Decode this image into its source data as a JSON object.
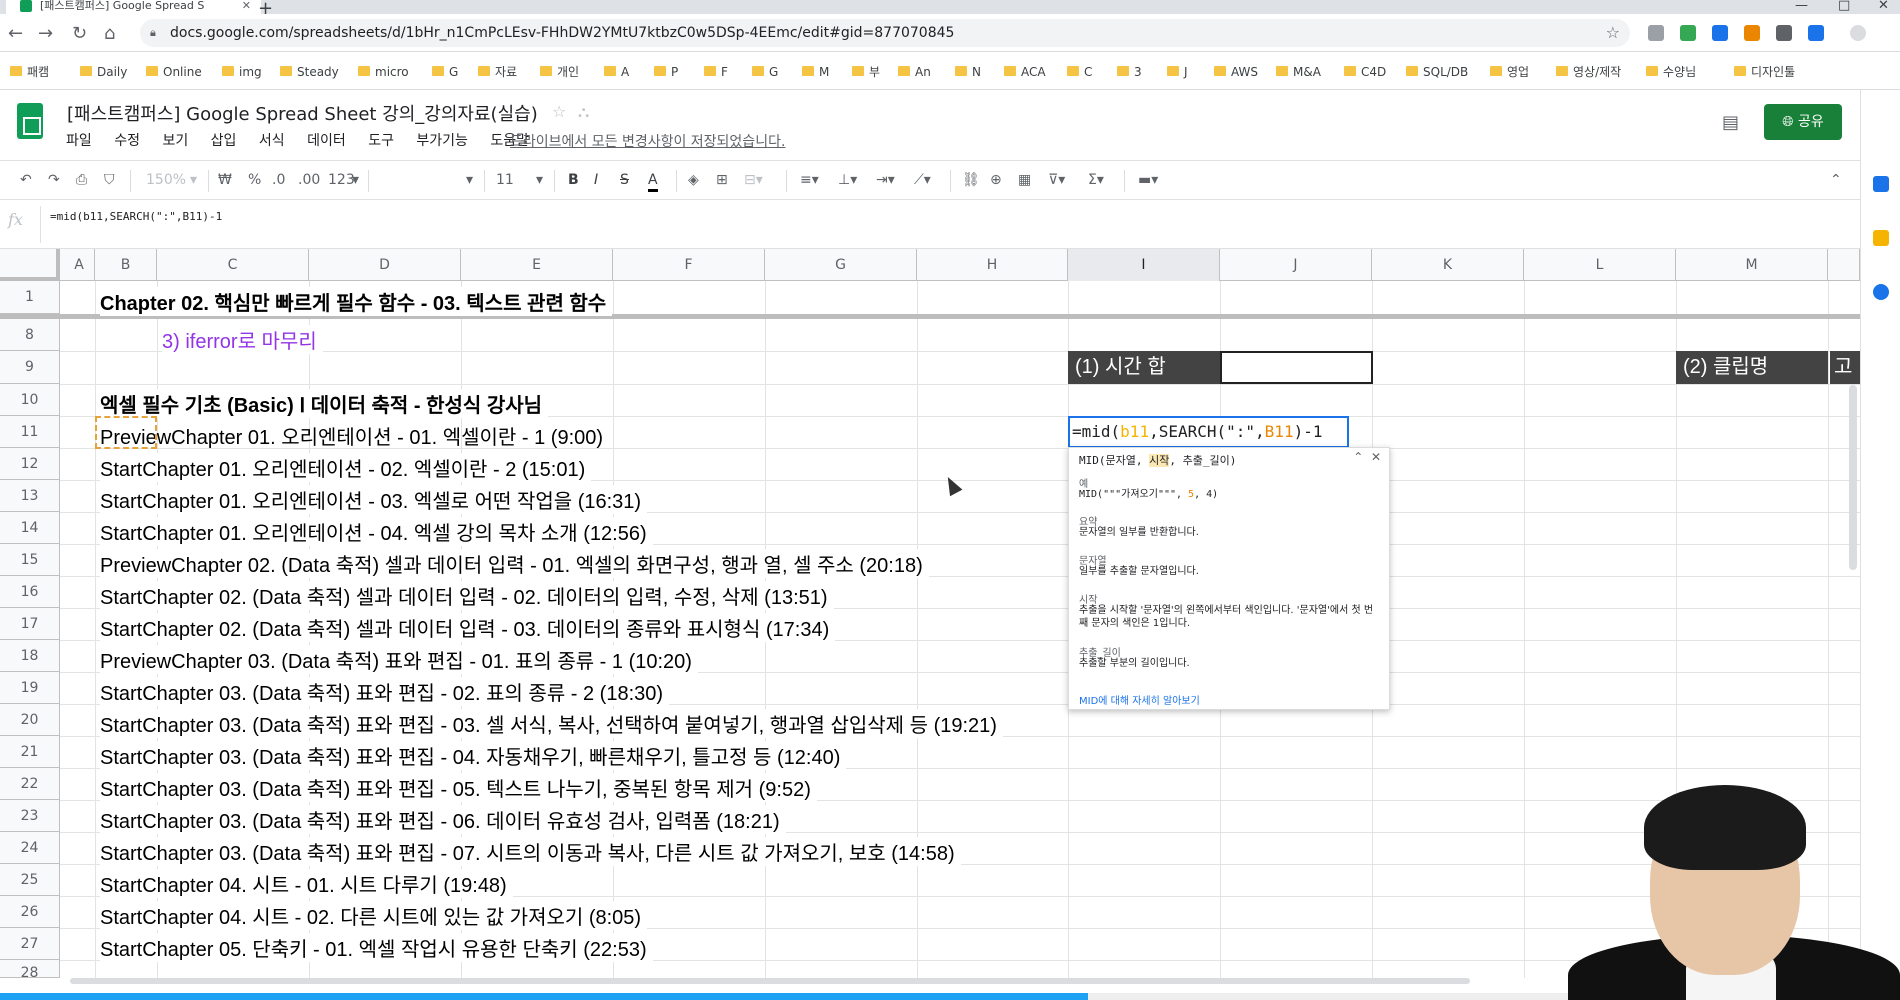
{
  "browser": {
    "tab_title": "[패스트캠퍼스] Google Spread S",
    "url": "docs.google.com/spreadsheets/d/1bHr_n1CmPcLEsv-FHhDW2YMtU7ktbzC0w5DSp-4EEmc/edit#gid=877070845",
    "bookmarks": [
      "패캠",
      "Daily",
      "Online",
      "img",
      "Steady",
      "micro",
      "G",
      "자료",
      "개인",
      "A",
      "P",
      "F",
      "G",
      "M",
      "부",
      "An",
      "N",
      "ACA",
      "C",
      "3",
      "J",
      "AWS",
      "M&A",
      "C4D",
      "SQL/DB",
      "영업",
      "영상/제작",
      "수양님",
      "디자인툴"
    ]
  },
  "doc": {
    "title": "[패스트캠퍼스] Google Spread Sheet 강의_강의자료(실습)",
    "menus": [
      "파일",
      "수정",
      "보기",
      "삽입",
      "서식",
      "데이터",
      "도구",
      "부가기능",
      "도움말"
    ],
    "save_status": "드라이브에서 모든 변경사항이 저장되었습니다.",
    "share_label": "공유"
  },
  "toolbar": {
    "zoom": "150%",
    "currency": "₩",
    "percent": "%",
    "dec_less": ".0",
    "dec_more": ".00",
    "format": "123",
    "font_size": "11",
    "bold": "B",
    "italic": "I",
    "strike": "S",
    "textcolor": "A"
  },
  "formula_bar": {
    "fx": "fx",
    "text": "=mid(b11,SEARCH(\":\",B11)-1"
  },
  "columns": [
    "A",
    "B",
    "C",
    "D",
    "E",
    "F",
    "G",
    "H",
    "I",
    "J",
    "K",
    "L",
    "M"
  ],
  "rows": [
    "1",
    "8",
    "9",
    "10",
    "11",
    "12",
    "13",
    "14",
    "15",
    "16",
    "17",
    "18",
    "19",
    "20",
    "21",
    "22",
    "23",
    "24",
    "25",
    "26",
    "27",
    "28"
  ],
  "cells": {
    "r1": "Chapter 02. 핵심만 빠르게 필수 함수 - 03. 텍스트 관련 함수",
    "r8": "3) iferror로 마무리",
    "r10": "엑셀 필수 기초 (Basic) Ⅰ 데이터 축적 - 한성식 강사님",
    "i9": "(1) 시간 합",
    "m9": "(2) 클립명",
    "n9": "고",
    "list": [
      "PreviewChapter 01. 오리엔테이션 - 01. 엑셀이란 - 1 (9:00)",
      "StartChapter 01. 오리엔테이션 - 02. 엑셀이란 - 2 (15:01)",
      "StartChapter 01. 오리엔테이션 - 03. 엑셀로 어떤 작업을 (16:31)",
      "StartChapter 01. 오리엔테이션 - 04. 엑셀 강의 목차 소개 (12:56)",
      "PreviewChapter 02. (Data 축적) 셀과 데이터 입력 - 01. 엑셀의 화면구성, 행과 열, 셀 주소 (20:18)",
      "StartChapter 02. (Data 축적) 셀과 데이터 입력 - 02. 데이터의 입력, 수정, 삭제 (13:51)",
      "StartChapter 02. (Data 축적) 셀과 데이터 입력 - 03. 데이터의 종류와 표시형식 (17:34)",
      "PreviewChapter 03. (Data 축적) 표와 편집 - 01. 표의 종류 - 1 (10:20)",
      "StartChapter 03. (Data 축적) 표와 편집 - 02. 표의 종류 - 2 (18:30)",
      "StartChapter 03. (Data 축적) 표와 편집 - 03. 셀 서식, 복사, 선택하여 붙여넣기, 행과열 삽입삭제 등 (19:21)",
      "StartChapter 03. (Data 축적) 표와 편집 - 04. 자동채우기, 빠른채우기, 틀고정 등 (12:40)",
      "StartChapter 03. (Data 축적) 표와 편집 - 05. 텍스트 나누기, 중복된 항목 제거 (9:52)",
      "StartChapter 03. (Data 축적) 표와 편집 - 06. 데이터 유효성 검사, 입력폼 (18:21)",
      "StartChapter 03. (Data 축적) 표와 편집 - 07. 시트의 이동과 복사, 다른 시트 값 가져오기, 보호 (14:58)",
      "StartChapter 04. 시트 - 01. 시트 다루기 (19:48)",
      "StartChapter 04. 시트 - 02. 다른 시트에 있는 값 가져오기 (8:05)",
      "StartChapter 05. 단축키 - 01. 엑셀 작업시 유용한 단축키 (22:53)"
    ]
  },
  "editor": {
    "p1": "=mid(",
    "p2": "b11",
    "p3": ",SEARCH(\":\",",
    "p4": "B11",
    "p5": ")-1"
  },
  "help": {
    "sig_a": "MID(문자열, ",
    "sig_b": "시작",
    "sig_c": ", 추출_길이)",
    "ex_label": "예",
    "ex_a": "MID(\"\"\"가져오기\"\"\", ",
    "ex_b": "5",
    "ex_c": ", 4)",
    "summary_label": "요약",
    "summary": "문자열의 일부를 반환합니다.",
    "arg1_label": "문자열",
    "arg1": "일부를 추출할 문자열입니다.",
    "arg2_label": "시작",
    "arg2": "추출을 시작할 '문자열'의 왼쪽에서부터 색인입니다. '문자열'에서 첫 번째 문자의 색인은 1입니다.",
    "arg3_label": "추출_길이",
    "arg3": "추출할 부분의 길이입니다.",
    "link": "MID에 대해 자세히 알아보기"
  },
  "colors": {
    "accent": "#1a73e8",
    "share": "#188038",
    "header_fill": "#434343",
    "purple_text": "#9334e6",
    "progress": "#1da1f2"
  }
}
